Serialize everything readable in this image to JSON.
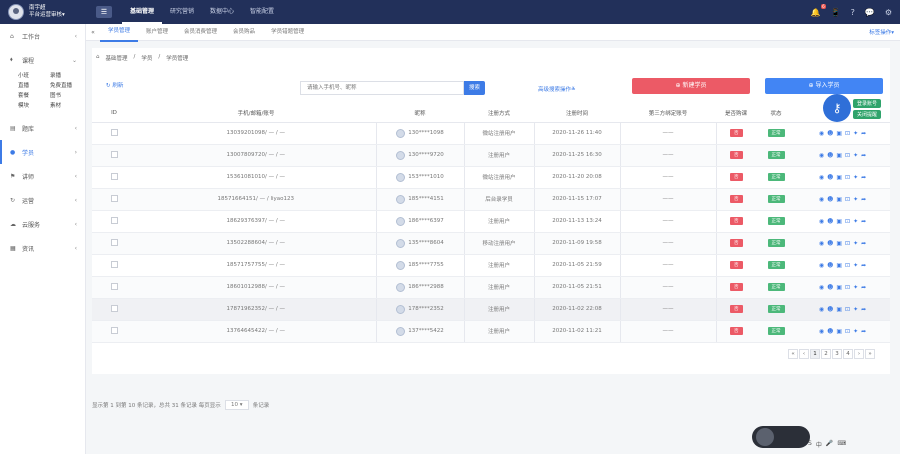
{
  "header": {
    "user_name": "南宇超",
    "user_role": "平台运营审核▾",
    "menu_icon": "menu-icon",
    "nav": [
      "基础管理",
      "研究营销",
      "数据中心",
      "智能配置"
    ],
    "active_nav": 0,
    "notice_badge": "6",
    "right_icons": [
      "bell-icon",
      "phone-icon",
      "help-icon",
      "chat-icon",
      "settings-icon"
    ]
  },
  "sidebar": {
    "items": [
      {
        "label": "工作台",
        "icon": "home-icon"
      },
      {
        "label": "课程",
        "icon": "tag-icon"
      },
      {
        "label": "题库",
        "icon": "file-icon"
      },
      {
        "label": "学员",
        "icon": "user-icon"
      },
      {
        "label": "讲师",
        "icon": "flag-icon"
      },
      {
        "label": "运营",
        "icon": "refresh-icon"
      },
      {
        "label": "云服务",
        "icon": "cloud-icon"
      },
      {
        "label": "资讯",
        "icon": "doc-icon"
      }
    ],
    "course_sub": [
      "小班",
      "录播",
      "直播",
      "免费直播",
      "套餐",
      "图书",
      "模块",
      "素材"
    ],
    "active_item": 3
  },
  "tabbar": {
    "tabs": [
      "学员管理",
      "账户管理",
      "会员消费管理",
      "会员购品",
      "学员错题管理"
    ],
    "right_label": "标签操作▾"
  },
  "breadcrumb": [
    "基础管理",
    "学员",
    "学员管理"
  ],
  "toolbar": {
    "refresh_label": "刷新",
    "search_placeholder": "请输入手机号、昵称",
    "search_label": "搜索",
    "advanced_label": "高级搜索操作≚",
    "new_label": "新建学员",
    "import_label": "导入学员"
  },
  "table": {
    "headers": [
      "ID",
      "手机/邮箱/账号",
      "昵称",
      "注册方式",
      "注册时间",
      "第三方绑定账号",
      "是否购课",
      "状态"
    ],
    "rows": [
      {
        "account": "13039201098/ — / —",
        "nick": "130****1098",
        "method": "微站注册用户",
        "time": "2020-11-26 11:40",
        "third": "——",
        "bought": "否",
        "status": "正常"
      },
      {
        "account": "13007809720/ — / —",
        "nick": "130****9720",
        "method": "注册用户",
        "time": "2020-11-25 16:30",
        "third": "——",
        "bought": "否",
        "status": "正常"
      },
      {
        "account": "15361081010/ — / —",
        "nick": "153****1010",
        "method": "微站注册用户",
        "time": "2020-11-20 20:08",
        "third": "——",
        "bought": "否",
        "status": "正常"
      },
      {
        "account": "18571664151/ — / liyao123",
        "nick": "185****4151",
        "method": "后台录学员",
        "time": "2020-11-15 17:07",
        "third": "——",
        "bought": "否",
        "status": "正常"
      },
      {
        "account": "18629376397/ — / —",
        "nick": "186****6397",
        "method": "注册用户",
        "time": "2020-11-13 13:24",
        "third": "——",
        "bought": "否",
        "status": "正常"
      },
      {
        "account": "13502288604/ — / —",
        "nick": "135****8604",
        "method": "移动注册用户",
        "time": "2020-11-09 19:58",
        "third": "——",
        "bought": "否",
        "status": "正常"
      },
      {
        "account": "18571757755/ — / —",
        "nick": "185****7755",
        "method": "注册用户",
        "time": "2020-11-05 21:59",
        "third": "——",
        "bought": "否",
        "status": "正常"
      },
      {
        "account": "18601012988/ — / —",
        "nick": "186****2988",
        "method": "注册用户",
        "time": "2020-11-05 21:51",
        "third": "——",
        "bought": "否",
        "status": "正常"
      },
      {
        "account": "17871962352/ — / —",
        "nick": "178****2352",
        "method": "注册用户",
        "time": "2020-11-02 22:08",
        "third": "——",
        "bought": "否",
        "status": "正常"
      },
      {
        "account": "13764645422/ — / —",
        "nick": "137****5422",
        "method": "注册用户",
        "time": "2020-11-02 11:21",
        "third": "——",
        "bought": "否",
        "status": "正常"
      }
    ],
    "op_icons": [
      "eye-icon",
      "users-icon",
      "bag-icon",
      "lock-icon",
      "gear-icon",
      "share-icon"
    ]
  },
  "pagination": {
    "summary": "显示第 1 到第 10 条记录，总共 31 条记录 每页显示",
    "page_size": "10 ▾",
    "suffix": "条记录",
    "pages": [
      "«",
      "‹",
      "1",
      "2",
      "3",
      "4",
      "›",
      "»"
    ],
    "active_page": "1"
  },
  "float": {
    "tag1": "登录账号",
    "tag2": "关闭提醒"
  }
}
